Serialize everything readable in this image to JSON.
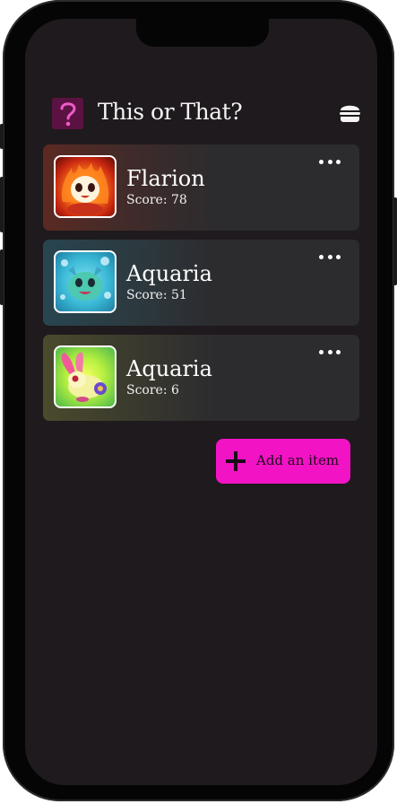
{
  "app": {
    "title": "This or That?",
    "logo_icon": "question-mark-icon",
    "menu_icon": "hamburger-menu-icon"
  },
  "items": [
    {
      "name": "Flarion",
      "score_label": "Score: 78",
      "thumbnail": "fire-creature-image",
      "accent": "#5b2a22"
    },
    {
      "name": "Aquaria",
      "score_label": "Score: 51",
      "thumbnail": "water-creature-image",
      "accent": "#284550"
    },
    {
      "name": "Aquaria",
      "score_label": "Score: 6",
      "thumbnail": "bunny-creature-image",
      "accent": "#4a4a2c"
    }
  ],
  "actions": {
    "add_item_label": "Add an item",
    "item_menu_icon": "more-horizontal-icon"
  },
  "colors": {
    "background": "#1f1a1d",
    "card": "#2c2b2e",
    "accent_button": "#f213c5",
    "logo_bg": "#5a1242",
    "logo_glyph": "#f05ac8"
  }
}
